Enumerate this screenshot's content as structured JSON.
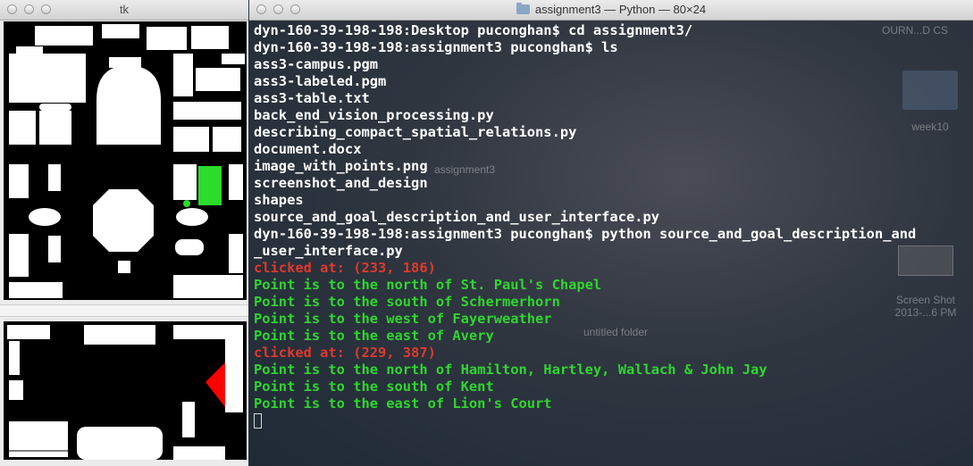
{
  "tk_window": {
    "title": "tk"
  },
  "terminal_window": {
    "title": "assignment3 — Python — 80×24",
    "lines": [
      {
        "text": "dyn-160-39-198-198:Desktop puconghan$ cd assignment3/",
        "color": "#ffffff"
      },
      {
        "text": "dyn-160-39-198-198:assignment3 puconghan$ ls",
        "color": "#ffffff"
      },
      {
        "text": "ass3-campus.pgm",
        "color": "#ffffff"
      },
      {
        "text": "ass3-labeled.pgm",
        "color": "#ffffff"
      },
      {
        "text": "ass3-table.txt",
        "color": "#ffffff"
      },
      {
        "text": "back_end_vision_processing.py",
        "color": "#ffffff"
      },
      {
        "text": "describing_compact_spatial_relations.py",
        "color": "#ffffff"
      },
      {
        "text": "document.docx",
        "color": "#ffffff"
      },
      {
        "text": "image_with_points.png",
        "color": "#ffffff"
      },
      {
        "text": "screenshot_and_design",
        "color": "#ffffff"
      },
      {
        "text": "shapes",
        "color": "#ffffff"
      },
      {
        "text": "source_and_goal_description_and_user_interface.py",
        "color": "#ffffff"
      },
      {
        "text": "dyn-160-39-198-198:assignment3 puconghan$ python source_and_goal_description_and",
        "color": "#ffffff"
      },
      {
        "text": "_user_interface.py",
        "color": "#ffffff"
      },
      {
        "text": "clicked at: (233, 186)",
        "color": "#e0392b"
      },
      {
        "text": "Point is to the north of St. Paul's Chapel",
        "color": "#2ed62e"
      },
      {
        "text": "Point is to the south of Schermerhorn",
        "color": "#2ed62e"
      },
      {
        "text": "Point is to the west of Fayerweather",
        "color": "#2ed62e"
      },
      {
        "text": "Point is to the east of Avery",
        "color": "#2ed62e"
      },
      {
        "text": "clicked at: (229, 387)",
        "color": "#e0392b"
      },
      {
        "text": "Point is to the north of Hamilton, Hartley, Wallach & John Jay",
        "color": "#2ed62e"
      },
      {
        "text": "Point is to the south of Kent",
        "color": "#2ed62e"
      },
      {
        "text": "Point is to the east of Lion's Court",
        "color": "#2ed62e"
      }
    ]
  },
  "desktop": {
    "label_top": "OURN...D CS",
    "folder_week10": "week10",
    "label_assignment3": "assignment3",
    "screenshot_label": "Screen Shot",
    "screenshot_date": "2013-...6 PM",
    "untitled_folder": "untitled folder"
  },
  "colors": {
    "source_marker": "#2bdc2b",
    "goal_marker": "#ff0000",
    "building": "#ffffff",
    "background": "#000000"
  }
}
